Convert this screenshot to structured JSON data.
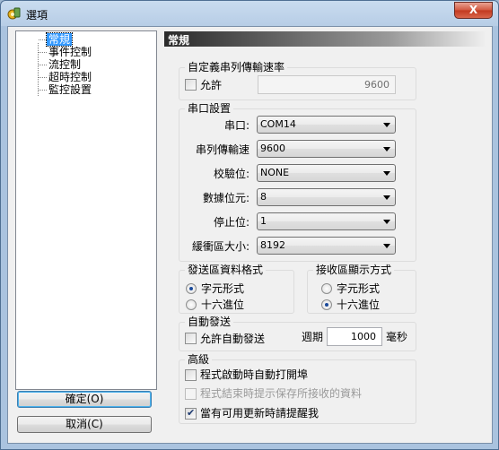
{
  "window": {
    "title": "選項",
    "close_glyph": "X",
    "icon": "app-icon"
  },
  "sidebar": {
    "items": [
      {
        "label": "常規",
        "selected": true
      },
      {
        "label": "事件控制"
      },
      {
        "label": "流控制"
      },
      {
        "label": "超時控制"
      },
      {
        "label": "監控設置"
      }
    ],
    "ok_label": "確定(O)",
    "cancel_label": "取消(C)"
  },
  "panel": {
    "header": "常規",
    "custom_baud": {
      "title": "自定義串列傳輸速率",
      "allow_label": "允許",
      "allow_checked": false,
      "value": "9600"
    },
    "port_settings": {
      "title": "串口設置",
      "fields": [
        {
          "label": "串口:",
          "value": "COM14"
        },
        {
          "label": "串列傳輸速",
          "value": "9600"
        },
        {
          "label": "校驗位:",
          "value": "NONE"
        },
        {
          "label": "數據位元:",
          "value": "8"
        },
        {
          "label": "停止位:",
          "value": "1"
        },
        {
          "label": "緩衝區大小:",
          "value": "8192"
        }
      ]
    },
    "send_format": {
      "title": "發送區資料格式",
      "options": [
        "字元形式",
        "十六進位"
      ],
      "selected": 0
    },
    "recv_format": {
      "title": "接收區顯示方式",
      "options": [
        "字元形式",
        "十六進位"
      ],
      "selected": 1
    },
    "auto_send": {
      "title": "自動發送",
      "allow_label": "允許自動發送",
      "allow_checked": false,
      "period_label": "週期",
      "period_value": "1000",
      "unit_label": "毫秒"
    },
    "advanced": {
      "title": "高級",
      "options": [
        {
          "label": "程式啟動時自動打開埠",
          "checked": false,
          "disabled": false
        },
        {
          "label": "程式結束時提示保存所接收的資料",
          "checked": false,
          "disabled": true
        },
        {
          "label": "當有可用更新時請提醒我",
          "checked": true,
          "disabled": false
        }
      ]
    }
  }
}
